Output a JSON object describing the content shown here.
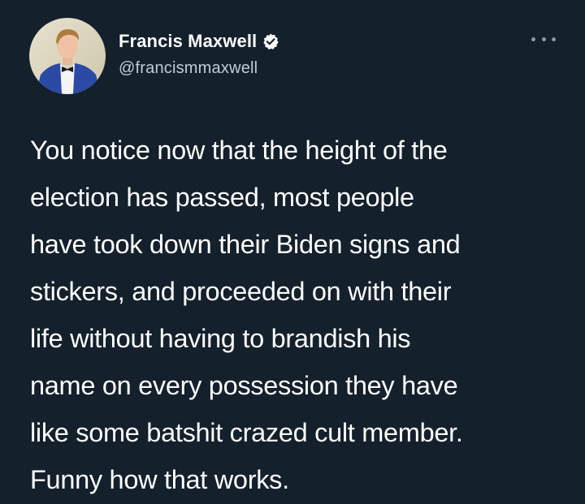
{
  "author": {
    "display_name": "Francis Maxwell",
    "handle": "@francismmaxwell",
    "verified": true
  },
  "tweet": {
    "lines": [
      "You notice now that the height of the",
      "election has passed, most people",
      "have took down their Biden signs and",
      "stickers, and proceeded on with their",
      "life without having to brandish his",
      "name on every possession they have",
      "like some batshit crazed cult member.",
      "Funny how that works."
    ]
  },
  "icons": {
    "verified": "verified-badge-icon",
    "more": "more-options-icon"
  },
  "colors": {
    "background": "#14202b",
    "text": "#ffffff",
    "handle": "#c2ccd4",
    "accent": "#ffffff"
  }
}
